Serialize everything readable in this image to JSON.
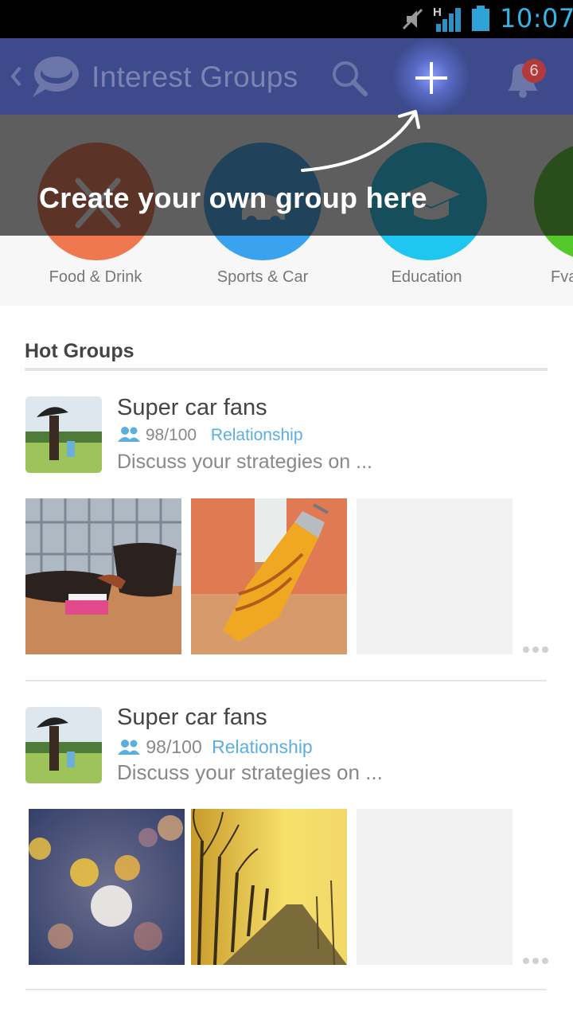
{
  "status_bar": {
    "time": "10:07",
    "network_letter": "H",
    "icons": [
      "mute-icon",
      "signal-icon",
      "battery-icon"
    ]
  },
  "app_bar": {
    "title": "Interest Groups",
    "notification_count": "6",
    "icons": [
      "back-chevron-icon",
      "chat-bubble-logo-icon",
      "search-icon",
      "plus-icon",
      "bell-icon"
    ]
  },
  "categories": [
    {
      "label": "Food & Drink",
      "color": "#f07850",
      "icon": "fork-knife-icon"
    },
    {
      "label": "Sports & Car",
      "color": "#3aa3f0",
      "icon": "car-icon"
    },
    {
      "label": "Education",
      "color": "#1ec6f0",
      "icon": "graduation-cap-icon"
    },
    {
      "label": "Fva",
      "color": "#55c82a",
      "icon": "category-icon"
    }
  ],
  "overlay": {
    "hint": "Create your own group here"
  },
  "hot_groups": {
    "title": "Hot Groups",
    "items": [
      {
        "name": "Super car fans",
        "count": "98/100",
        "tag": "Relationship",
        "description": "Discuss your strategies on ...",
        "photos": [
          "lounge-chair-photo",
          "broom-photo",
          "empty-photo"
        ]
      },
      {
        "name": "Super car fans",
        "count": "98/100",
        "tag": "Relationship",
        "description": "Discuss your strategies on ...",
        "photos": [
          "bokeh-lights-photo",
          "tree-lined-road-photo",
          "empty-photo"
        ]
      }
    ]
  },
  "colors": {
    "status_bar_bg": "#000000",
    "time_text": "#35b5e5",
    "app_bar_bg": "#3d4a8c",
    "tag_text": "#5aaee0",
    "badge_bg": "#b23a3a"
  }
}
